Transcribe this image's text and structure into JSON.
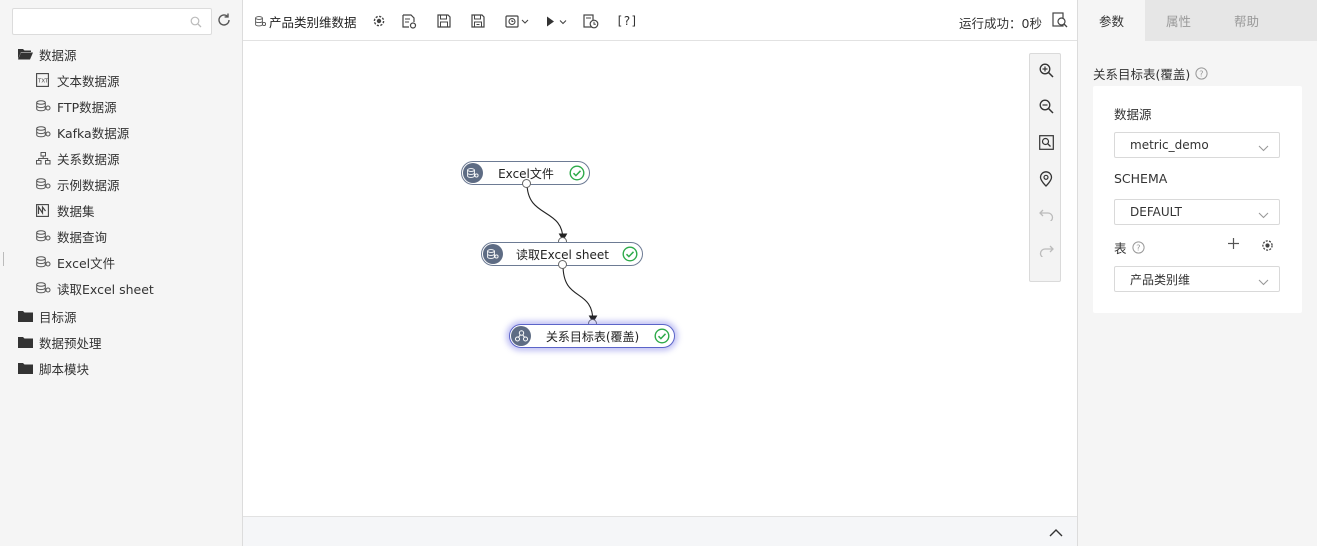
{
  "sidebar": {
    "search_placeholder": "",
    "tree": {
      "folders": [
        {
          "label": "数据源"
        },
        {
          "label": "目标源"
        },
        {
          "label": "数据预处理"
        },
        {
          "label": "脚本模块"
        }
      ],
      "datasource_items": [
        {
          "label": "文本数据源",
          "icon": "text-file-icon"
        },
        {
          "label": "FTP数据源",
          "icon": "database-icon"
        },
        {
          "label": "Kafka数据源",
          "icon": "database-icon"
        },
        {
          "label": "关系数据源",
          "icon": "hierarchy-icon"
        },
        {
          "label": "示例数据源",
          "icon": "database-icon"
        },
        {
          "label": "数据集",
          "icon": "chart-icon"
        },
        {
          "label": "数据查询",
          "icon": "database-icon"
        },
        {
          "label": "Excel文件",
          "icon": "database-icon"
        },
        {
          "label": "读取Excel sheet",
          "icon": "database-icon"
        }
      ]
    }
  },
  "toolbar": {
    "tab_title": "产品类别维数据",
    "help_label": "[?]",
    "run_status": "运行成功：0秒"
  },
  "flow": {
    "nodes": [
      {
        "label": "Excel文件",
        "status": "success"
      },
      {
        "label": "读取Excel sheet",
        "status": "success"
      },
      {
        "label": "关系目标表(覆盖)",
        "status": "success"
      }
    ]
  },
  "right_panel": {
    "tabs": [
      {
        "label": "参数",
        "active": true
      },
      {
        "label": "属性",
        "active": false
      },
      {
        "label": "帮助",
        "active": false
      }
    ],
    "title": "关系目标表(覆盖)",
    "datasource_label": "数据源",
    "datasource_value": "metric_demo",
    "schema_label": "SCHEMA",
    "schema_value": "DEFAULT",
    "table_label": "表",
    "table_value": "产品类别维"
  },
  "colors": {
    "node_border": "#6d7b94",
    "node_icon_bg": "#5e6c84",
    "success_green": "#2eaa4a",
    "selected_glow": "#5b64c8"
  }
}
